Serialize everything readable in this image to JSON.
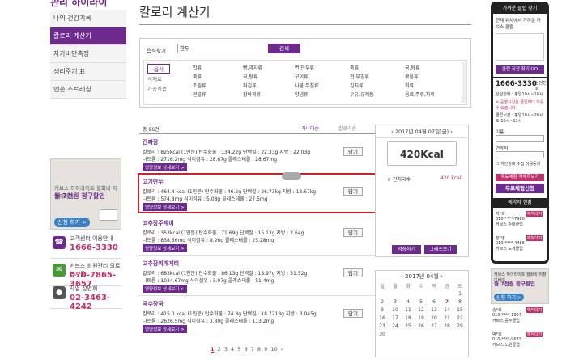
{
  "sidebar": {
    "brand": "관리 하이라이",
    "menu": [
      "나의 건강기록",
      "칼로리 계산기",
      "자가비만측정",
      "생리주기 표",
      "맨손 스트레칭"
    ],
    "ad": {
      "line1": "커브스 하이라이트 월화비 저장이바이",
      "line2": "월 7천원 청구할인",
      "btn": "신청 하기 >"
    },
    "contacts": [
      {
        "label": "고객센터 이용안내",
        "value": "1666-3330"
      },
      {
        "label": "커브스 회원관리 의료복지몸",
        "value": "070-7865-3657"
      },
      {
        "label": "사업 설명회",
        "value": "02-3463-4242"
      }
    ]
  },
  "main": {
    "title": "칼로리 계산기",
    "search": {
      "label": "음식찾기",
      "value": "한두",
      "button": "검색"
    },
    "categories": [
      "음식",
      "식재료",
      "가공식품"
    ],
    "foods": [
      [
        "밥류",
        "죽류",
        "조림류",
        "전골류",
        "고기류"
      ],
      [
        "빵,과자류",
        "국,탕류",
        "튀김류",
        "장아찌류",
        "양념류"
      ],
      [
        "면,만두류",
        "구이류",
        "나물,무침류",
        "양념류",
        ""
      ],
      [
        "죽류",
        "전,부침류",
        "김치류",
        "우유,유제품",
        "끼니"
      ],
      [
        "국,탕류",
        "볶음류",
        "회류",
        "음료,주류,차류",
        ""
      ]
    ],
    "list_header": {
      "count": "총 96건",
      "sort1": "가나다순",
      "sort2": "칼로리순"
    },
    "items": [
      {
        "name": "간짜장",
        "line1": "칼로리 : 825kcal (1인분)   탄수화물 : 134.22g   단백질 : 22.33g   지방 : 22.03g",
        "line2": "나트륨 : 2716.2mg   식이섬유 : 28.67g   콜레스테롤 : 28.67mg",
        "btn": "담기",
        "detail": "영양정보 상세보기 >"
      },
      {
        "name": "고기만두",
        "line1": "칼로리 : 464.4 kcal (1인분)   탄수화물 : 46.2g   단백질 : 26.73kg   지방 : 18.67kg",
        "line2": "나트륨 : 574.8mg   식이섬유 : 5.08g   콜레스테롤 : 27.5mg",
        "btn": "담기",
        "detail": "영양정보 상세보기 >"
      },
      {
        "name": "고추장주제비",
        "line1": "칼로리 : 353kcal (1인분)   탄수화물 : 71.69g   단백질 : 15.13g   지방 : 2.64g",
        "line2": "나트륨 : 838.56mg   식이섬유 : 8.26g   콜레스테롤 : 25.28mg",
        "btn": "담기",
        "detail": "영양정보 상세보기 >"
      },
      {
        "name": "고추장찌개게티",
        "line1": "칼로리 : 683kcal (1인분)   탄수화물 : 86.13g   단백질 : 18.97g   지방 : 31.52g",
        "line2": "나트륨 : 1034.67mg   식이섬유 : 3.97g   콜레스테롤 : 51.4mg",
        "btn": "담기",
        "detail": "영양정보 상세보기 >"
      },
      {
        "name": "국수장국",
        "line1": "칼로리 : 415.0 kcal (1인분)   탄수화물 : 74.8g   단백질 : 18.7213g   지방 : 3.045g",
        "line2": "나트륨 : 2626.5mg   식이섬유 : 3.30g   콜레스테롤 : 113.2mg",
        "btn": "담기",
        "detail": "영양정보 상세보기 >"
      }
    ],
    "pagination": [
      "1",
      "2",
      "3",
      "4",
      "5",
      "6",
      "7",
      "8",
      "9",
      "10"
    ]
  },
  "calorie_panel": {
    "date": "2017년 04월 07일(금)",
    "total": "420Kcal",
    "entry": {
      "name": "잔치국수",
      "kcal": "420 kcal"
    },
    "save": "저장하기",
    "graph": "그래프보기"
  },
  "calendar": {
    "title": "2017년 04월",
    "days": [
      "일",
      "월",
      "화",
      "수",
      "목",
      "금",
      "토"
    ],
    "weeks": [
      [
        "",
        "",
        "",
        "",
        "",
        "",
        "1"
      ],
      [
        "2",
        "3",
        "4",
        "5",
        "6",
        "7",
        "8"
      ],
      [
        "9",
        "10",
        "11",
        "12",
        "13",
        "14",
        "15"
      ],
      [
        "16",
        "17",
        "18",
        "19",
        "20",
        "21",
        "22"
      ],
      [
        "23",
        "24",
        "25",
        "26",
        "27",
        "28",
        "29"
      ],
      [
        "30",
        "",
        "",
        "",
        "",
        "",
        ""
      ]
    ]
  },
  "right": {
    "club_title": "가까운 클럽 찾기",
    "club_desc": "현재 위치에서 가까운 커브스 클럽",
    "find_btn": "클럽 직접 찾기 GO",
    "phone": "1666-3330",
    "phone_side": "상담전화",
    "hours": "상담전화 : 평일10시~18시",
    "notice": "※ 운영시간은 클럽마다 다를 수 있습니다.",
    "hours2": "클럽시간 : 평일10시~20시 토 10시~13시",
    "name_label": "이름",
    "phone_label": "연락처",
    "agree": "개인정보 수집 이용동의",
    "view_btn": "무료체험 자세히보기",
    "apply_btn": "무료체험신청",
    "reserve_title": "예약자 현황",
    "reservations": [
      {
        "name": "지*희",
        "phone": "010-****-7980",
        "club": "커브스 수내클럽",
        "status": "예약대기"
      },
      {
        "name": "장*영",
        "phone": "010-****-4486",
        "club": "커브스 도게클럽",
        "status": "예약대기"
      },
      {
        "name": "송*희",
        "phone": "010-****-1907",
        "club": "커브스 공주클럽",
        "status": "예약대기"
      },
      {
        "name": "박*희",
        "phone": "010-****-9633",
        "club": "커브스 노원클럽",
        "status": "예약대기"
      }
    ],
    "ad": {
      "line1": "커브스 하이라이트 월화비 저장이바이",
      "line2": "월 7천원 청구할인",
      "btn": "신청 하기 >"
    }
  }
}
